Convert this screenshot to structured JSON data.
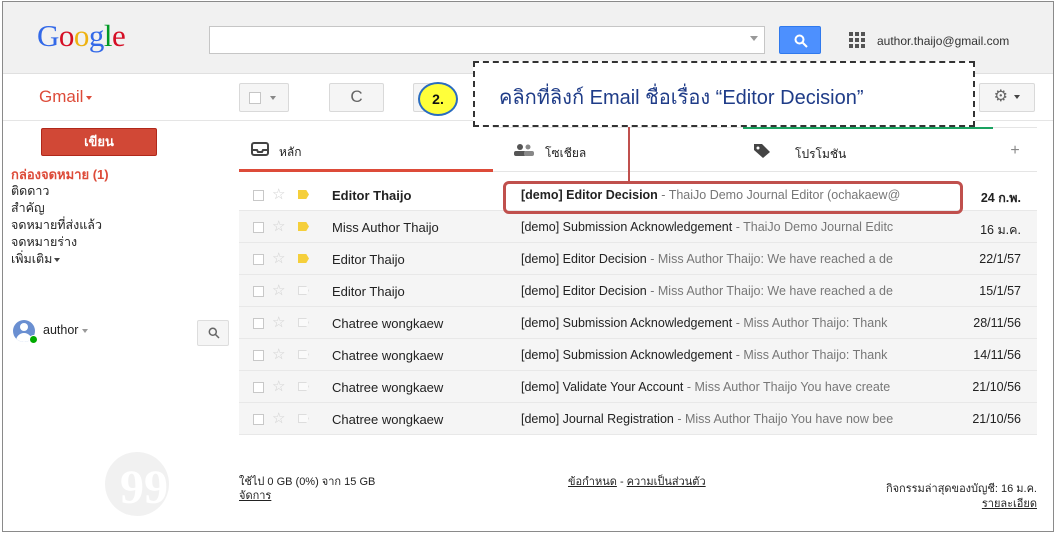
{
  "header": {
    "logo": "Google",
    "account_email": "author.thaijo@gmail.com",
    "search_placeholder": ""
  },
  "toolbar": {
    "gmail_label": "Gmail",
    "refresh_glyph": "C",
    "settings_glyph": "⚙"
  },
  "sidebar": {
    "compose_label": "เขียน",
    "items": [
      {
        "label": "กล่องจดหมาย (1)",
        "active": true
      },
      {
        "label": "ติดดาว"
      },
      {
        "label": "สำคัญ"
      },
      {
        "label": "จดหมายที่ส่งแล้ว"
      },
      {
        "label": "จดหมายร่าง"
      },
      {
        "label": "เพิ่มเติม"
      }
    ],
    "chat_user": "author"
  },
  "tabs": [
    {
      "label": "หลัก",
      "icon": "inbox-icon"
    },
    {
      "label": "โซเชียล",
      "icon": "people-icon"
    },
    {
      "label": "โปรโมชัน",
      "icon": "tag-icon"
    },
    {
      "label": "+",
      "icon": "add-icon"
    }
  ],
  "emails": [
    {
      "sender": "Editor Thaijo",
      "subject": "[demo] Editor Decision",
      "snippet": " - ThaiJo Demo Journal Editor (ochakaew@",
      "date": "24 ก.พ.",
      "unread": true,
      "important": true
    },
    {
      "sender": "Miss Author Thaijo",
      "subject": "[demo] Submission Acknowledgement",
      "snippet": " - ThaiJo Demo Journal Editc",
      "date": "16 ม.ค.",
      "unread": false,
      "important": true
    },
    {
      "sender": "Editor Thaijo",
      "subject": "[demo] Editor Decision",
      "snippet": " - Miss Author Thaijo: We have reached a de",
      "date": "22/1/57",
      "unread": false,
      "important": true
    },
    {
      "sender": "Editor Thaijo",
      "subject": "[demo] Editor Decision",
      "snippet": " - Miss Author Thaijo: We have reached a de",
      "date": "15/1/57",
      "unread": false,
      "important": false
    },
    {
      "sender": "Chatree wongkaew",
      "subject": "[demo] Submission Acknowledgement",
      "snippet": " - Miss Author Thaijo: Thank",
      "date": "28/11/56",
      "unread": false,
      "important": false
    },
    {
      "sender": "Chatree wongkaew",
      "subject": "[demo] Submission Acknowledgement",
      "snippet": " - Miss Author Thaijo: Thank",
      "date": "14/11/56",
      "unread": false,
      "important": false
    },
    {
      "sender": "Chatree wongkaew",
      "subject": "[demo] Validate Your Account",
      "snippet": " - Miss Author Thaijo You have create",
      "date": "21/10/56",
      "unread": false,
      "important": false
    },
    {
      "sender": "Chatree wongkaew",
      "subject": "[demo] Journal Registration",
      "snippet": " - Miss Author Thaijo You have now bee",
      "date": "21/10/56",
      "unread": false,
      "important": false
    }
  ],
  "footer": {
    "usage": "ใช้ไป 0 GB (0%) จาก 15 GB",
    "manage": "จัดการ",
    "terms": "ข้อกำหนด",
    "separator": " - ",
    "privacy": "ความเป็นส่วนตัว",
    "activity": "กิจกรรมล่าสุดของบัญชี: 16 ม.ค.",
    "details": "รายละเอียด"
  },
  "annotation": {
    "step": "2.",
    "instruction": "คลิกที่ลิงก์ Email ชื่อเรื่อง “Editor Decision”",
    "accent_color": "#c0504d"
  }
}
